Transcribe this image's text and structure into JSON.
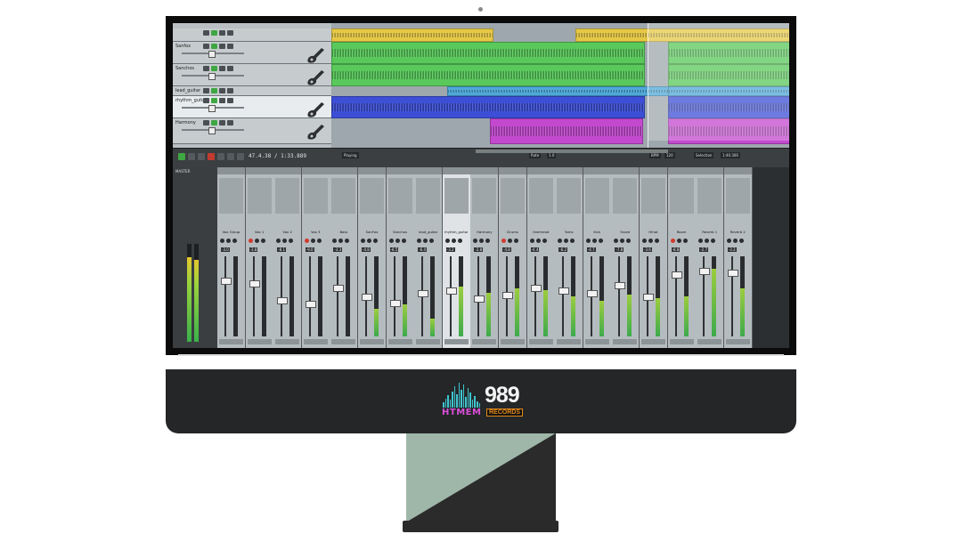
{
  "brand": {
    "name_left": "HTMEM",
    "name_number": "989",
    "name_right": "RECORDS",
    "bar_heights": [
      6,
      10,
      14,
      9,
      18,
      24,
      15,
      28,
      20,
      26,
      12,
      22,
      17,
      9,
      13,
      7,
      5
    ],
    "colors": {
      "bars": "#3fc4cf",
      "left": "#d94fd6",
      "right": "#e58a17"
    }
  },
  "daw": {
    "tracks": [
      {
        "name": "",
        "selected": false,
        "color": "#e6c845",
        "items": [
          [
            0,
            180
          ],
          [
            274,
            240
          ]
        ]
      },
      {
        "name": "Sanfox",
        "selected": false,
        "color": "#58c95a",
        "items": [
          [
            0,
            350
          ],
          [
            378,
            136
          ]
        ]
      },
      {
        "name": "Sanchos",
        "selected": false,
        "color": "#58c95a",
        "items": [
          [
            0,
            350
          ],
          [
            378,
            136
          ]
        ]
      },
      {
        "name": "lead_guitar",
        "selected": false,
        "color": "#4ea9d9",
        "items": [
          [
            130,
            250
          ],
          [
            378,
            136
          ]
        ]
      },
      {
        "name": "rhythm_guitar",
        "selected": true,
        "color": "#3d4fd6",
        "items": [
          [
            0,
            350
          ],
          [
            378,
            136
          ]
        ]
      },
      {
        "name": "Harmony",
        "selected": false,
        "color": "#c349cf",
        "items": [
          [
            178,
            170
          ],
          [
            378,
            136
          ]
        ]
      }
    ],
    "transport": {
      "time": "47.4.38 / 1:33.889",
      "fields": [
        "Playing",
        "Rate",
        "1.0",
        "BPM",
        "120",
        "Selection",
        "1:40.306"
      ]
    },
    "mixer": {
      "master_label": "MASTER",
      "channels": [
        {
          "name": "Vox Group",
          "vol": "-3.0",
          "meter": 0,
          "fader": 0.72,
          "rec": false
        },
        {
          "name": "Vox 1",
          "vol": "-3.8",
          "meter": 0,
          "fader": 0.68,
          "rec": true
        },
        {
          "name": "Vox 2",
          "vol": "-8.1",
          "meter": 0,
          "fader": 0.45,
          "rec": false
        },
        {
          "name": "Vox 3",
          "vol": "-9.0",
          "meter": 0,
          "fader": 0.4,
          "rec": true
        },
        {
          "name": "Bass",
          "vol": "-3.3",
          "meter": 0,
          "fader": 0.62,
          "rec": false
        },
        {
          "name": "SanFox",
          "vol": "-4.8",
          "meter": 0.35,
          "fader": 0.5,
          "rec": false
        },
        {
          "name": "Sanchos",
          "vol": "-8.5",
          "meter": 0.4,
          "fader": 0.42,
          "rec": false
        },
        {
          "name": "lead_guitar",
          "vol": "-6.4",
          "meter": 0.22,
          "fader": 0.55,
          "rec": false
        },
        {
          "name": "rhythm_guitar",
          "vol": "-3.2",
          "meter": 0.62,
          "fader": 0.58,
          "rec": false,
          "highlight": true
        },
        {
          "name": "Harmony",
          "vol": "-2.8",
          "meter": 0.55,
          "fader": 0.48,
          "rec": false
        },
        {
          "name": "Drums",
          "vol": "-4.8",
          "meter": 0.6,
          "fader": 0.52,
          "rec": true
        },
        {
          "name": "Overhead",
          "vol": "-4.4",
          "meter": 0.58,
          "fader": 0.62,
          "rec": false
        },
        {
          "name": "Toms",
          "vol": "-6.2",
          "meter": 0.5,
          "fader": 0.58,
          "rec": false
        },
        {
          "name": "Kick",
          "vol": "-4.7",
          "meter": 0.45,
          "fader": 0.55,
          "rec": false
        },
        {
          "name": "Snare",
          "vol": "-7.8",
          "meter": 0.52,
          "fader": 0.65,
          "rec": false
        },
        {
          "name": "Hihat",
          "vol": "-3.6",
          "meter": 0.48,
          "fader": 0.5,
          "rec": false
        },
        {
          "name": "Room",
          "vol": "-8.8",
          "meter": 0.5,
          "fader": 0.8,
          "rec": true
        },
        {
          "name": "Reverb 1",
          "vol": "-2.7",
          "meter": 0.85,
          "fader": 0.85,
          "rec": false
        },
        {
          "name": "Reverb 2",
          "vol": "-3.3",
          "meter": 0.6,
          "fader": 0.82,
          "rec": false
        }
      ]
    }
  }
}
